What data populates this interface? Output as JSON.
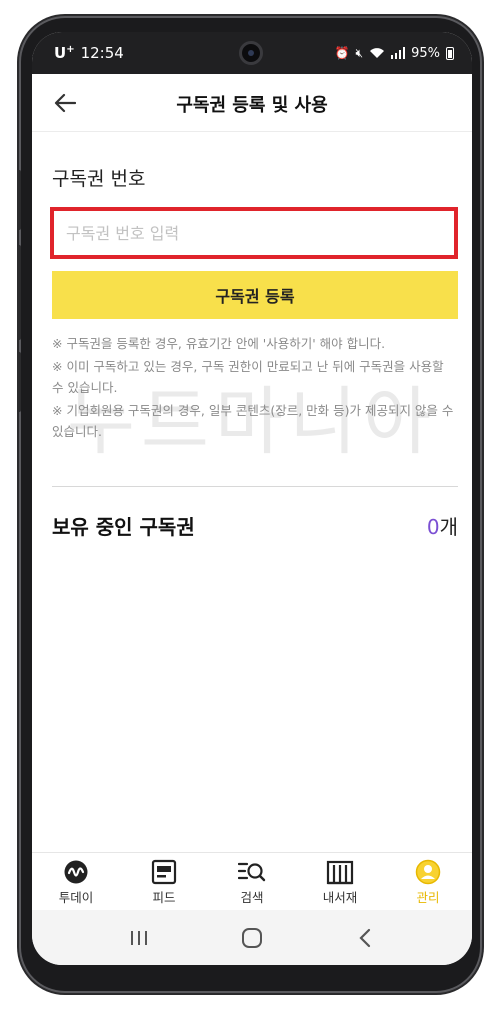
{
  "status_bar": {
    "carrier": "U",
    "carrier_sup": "+",
    "time": "12:54",
    "battery": "95%"
  },
  "header": {
    "title": "구독권 등록 및 사용"
  },
  "form": {
    "label": "구독권 번호",
    "input_value": "",
    "input_placeholder": "구독권 번호 입력",
    "register_button": "구독권 등록"
  },
  "notes": [
    "※ 구독권을 등록한 경우, 유효기간 안에 '사용하기' 해야 합니다.",
    "※ 이미 구독하고 있는 경우, 구독 권한이 만료되고 난 뒤에 구독권을 사용할 수 있습니다.",
    "※ 기업회원용 구독권의 경우, 일부 콘텐츠(장르, 만화 등)가 제공되지 않을 수 있습니다."
  ],
  "watermark": "누트마니아",
  "owned": {
    "title": "보유 중인 구독권",
    "count": "0",
    "unit": "개"
  },
  "tabs": [
    {
      "label": "투데이",
      "icon": "today-icon",
      "active": false
    },
    {
      "label": "피드",
      "icon": "feed-icon",
      "active": false
    },
    {
      "label": "검색",
      "icon": "search-icon",
      "active": false
    },
    {
      "label": "내서재",
      "icon": "library-icon",
      "active": false
    },
    {
      "label": "관리",
      "icon": "profile-icon",
      "active": true
    }
  ],
  "colors": {
    "accent_yellow": "#f8e04b",
    "active_tab": "#e7b800",
    "highlight_red": "#e0242b",
    "count_purple": "#7b4fd3"
  }
}
